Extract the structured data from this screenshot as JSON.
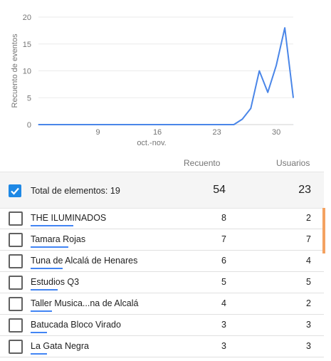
{
  "chart_data": {
    "type": "line",
    "ylabel": "Recuento de eventos",
    "xlabel": "oct.-nov.",
    "y_ticks": [
      "0",
      "5",
      "10",
      "15",
      "20"
    ],
    "ylim": [
      0,
      20
    ],
    "x_ticks": [
      {
        "day": 9,
        "label": "9"
      },
      {
        "day": 16,
        "label": "16"
      },
      {
        "day": 23,
        "label": "23"
      },
      {
        "day": 30,
        "label": "30"
      }
    ],
    "xlim": [
      2,
      32
    ],
    "grid": true,
    "series": [
      {
        "color": "#4a86e8",
        "x": [
          2,
          3,
          4,
          5,
          6,
          7,
          8,
          9,
          10,
          11,
          12,
          13,
          14,
          15,
          16,
          17,
          18,
          19,
          20,
          21,
          22,
          23,
          24,
          25,
          26,
          27,
          28,
          29,
          30,
          31,
          32
        ],
        "y": [
          0,
          0,
          0,
          0,
          0,
          0,
          0,
          0,
          0,
          0,
          0,
          0,
          0,
          0,
          0,
          0,
          0,
          0,
          0,
          0,
          0,
          0,
          0,
          0,
          1,
          3,
          10,
          6,
          11,
          18,
          5
        ]
      }
    ]
  },
  "table": {
    "col_count_label": "Recuento",
    "col_users_label": "Usuarios",
    "total_label": "Total de elementos: 19",
    "total_count": "54",
    "total_users": "23",
    "rows": [
      {
        "name": "THE ILUMINADOS",
        "count": "8",
        "users": "2",
        "share": 1.0
      },
      {
        "name": "Tamara Rojas",
        "count": "7",
        "users": "7",
        "share": 0.875
      },
      {
        "name": "Tuna de Alcalá de Henares",
        "count": "6",
        "users": "4",
        "share": 0.75
      },
      {
        "name": "Estudios Q3",
        "count": "5",
        "users": "5",
        "share": 0.625
      },
      {
        "name": "Taller Musica...na de Alcalá",
        "count": "4",
        "users": "2",
        "share": 0.5
      },
      {
        "name": "Batucada Bloco Virado",
        "count": "3",
        "users": "3",
        "share": 0.375
      },
      {
        "name": "La Gata Negra",
        "count": "3",
        "users": "3",
        "share": 0.375
      }
    ]
  },
  "colors": {
    "accent": "#1e88e5",
    "line": "#4a86e8",
    "scroll_thumb": "#f4a261"
  },
  "icons": {
    "select_all": "checkbox-checked-icon",
    "row": "checkbox-empty-icon"
  }
}
